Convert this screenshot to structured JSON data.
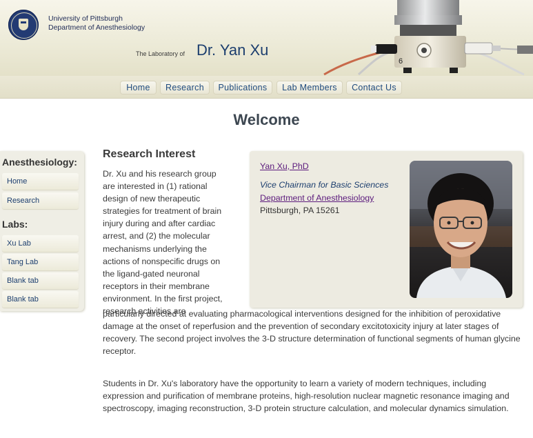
{
  "header": {
    "university": "University of Pittsburgh",
    "department": "Department of Anesthesiology",
    "lab_prefix": "The Laboratory of",
    "lab_name": "Dr. Yan Xu"
  },
  "nav": {
    "items": [
      {
        "label": "Home"
      },
      {
        "label": "Research"
      },
      {
        "label": "Publications"
      },
      {
        "label": "Lab Members"
      },
      {
        "label": "Contact Us"
      }
    ]
  },
  "welcome": "Welcome",
  "sidebar": {
    "heading_anesthesiology": "Anesthesiology:",
    "anesthesiology_items": [
      {
        "label": "Home"
      },
      {
        "label": "Research"
      }
    ],
    "heading_labs": "Labs:",
    "lab_items": [
      {
        "label": "Xu Lab"
      },
      {
        "label": "Tang Lab"
      },
      {
        "label": "Blank tab"
      },
      {
        "label": "Blank tab"
      }
    ]
  },
  "main": {
    "research_heading": "Research Interest",
    "para1_narrow": "Dr. Xu and his research group are interested in (1) rational design of new therapeutic strategies for treatment of brain injury during and after cardiac arrest, and (2) the molecular mechanisms underlying the actions of nonspecific drugs on the ligand-gated neuronal receptors in their membrane environment. In the first project, research activities are",
    "para1_wide": "particularly directed at evaluating pharmacological interventions designed for the inhibition of peroxidative damage at the onset of reperfusion and the prevention of secondary excitotoxicity injury at later stages of recovery. The second project involves the 3-D structure determination of functional segments of human glycine receptor.",
    "para2": "Students in Dr. Xu's laboratory have the opportunity to learn a variety of modern techniques, including expression and purification of membrane proteins, high-resolution nuclear magnetic resonance imaging and spectroscopy, imaging reconstruction, 3-D protein structure calculation, and molecular dynamics simulation."
  },
  "profile": {
    "name_link": "Yan Xu, PhD",
    "title": "Vice Chairman for Basic Sciences",
    "dept_link": "Department of Anesthesiology",
    "address": "Pittsburgh, PA 15261"
  }
}
